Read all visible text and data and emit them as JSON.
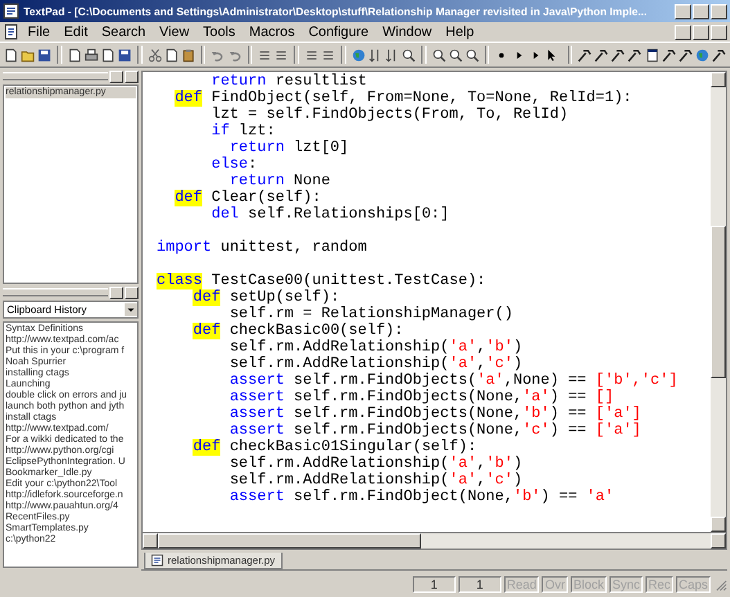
{
  "window": {
    "title": "TextPad - [C:\\Documents and Settings\\Administrator\\Desktop\\stuff\\Relationship Manager revisited in Java\\Python Imple..."
  },
  "menu": [
    "File",
    "Edit",
    "Search",
    "View",
    "Tools",
    "Macros",
    "Configure",
    "Window",
    "Help"
  ],
  "left_panel": {
    "documents": [
      {
        "label": "relationshipmanager.py",
        "selected": true
      }
    ],
    "clip_dropdown": "Clipboard History",
    "clips": [
      "Syntax Definitions",
      "http://www.textpad.com/ac",
      "Put this in your c:\\program f",
      "Noah Spurrier",
      "installing ctags",
      "Launching",
      "double click on errors and ju",
      "launch both python and jyth",
      "install ctags",
      "http://www.textpad.com/",
      "For a wikki dedicated to the",
      "http://www.python.org/cgi",
      "EclipsePythonIntegration. U",
      "Bookmarker_Idle.py",
      "Edit your c:\\python22\\Tool",
      "http://idlefork.sourceforge.n",
      "http://www.pauahtun.org/4",
      "RecentFiles.py",
      "SmartTemplates.py",
      "c:\\python22"
    ]
  },
  "editor": {
    "lines": [
      {
        "kind": "code",
        "segments": [
          {
            "kind": "kw",
            "text": "      return"
          },
          {
            "kind": "plain",
            "text": " resultlist"
          }
        ]
      },
      {
        "kind": "code",
        "segments": [
          {
            "kind": "def",
            "text": "  def"
          },
          {
            "kind": "plain",
            "text": " FindObject(self, From=None, To=None, RelId=1):"
          }
        ]
      },
      {
        "kind": "code",
        "segments": [
          {
            "kind": "plain",
            "text": "      lzt = self.FindObjects(From, To, RelId)"
          }
        ]
      },
      {
        "kind": "code",
        "segments": [
          {
            "kind": "kw",
            "text": "      if"
          },
          {
            "kind": "plain",
            "text": " lzt:"
          }
        ]
      },
      {
        "kind": "code",
        "segments": [
          {
            "kind": "kw",
            "text": "        return"
          },
          {
            "kind": "plain",
            "text": " lzt[0]"
          }
        ]
      },
      {
        "kind": "code",
        "segments": [
          {
            "kind": "kw",
            "text": "      else"
          },
          {
            "kind": "plain",
            "text": ":"
          }
        ]
      },
      {
        "kind": "code",
        "segments": [
          {
            "kind": "kw",
            "text": "        return"
          },
          {
            "kind": "plain",
            "text": " None"
          }
        ]
      },
      {
        "kind": "code",
        "segments": [
          {
            "kind": "def",
            "text": "  def"
          },
          {
            "kind": "plain",
            "text": " Clear(self):"
          }
        ]
      },
      {
        "kind": "code",
        "segments": [
          {
            "kind": "kw",
            "text": "      del"
          },
          {
            "kind": "plain",
            "text": " self.Relationships[0:]"
          }
        ]
      },
      {
        "kind": "blank"
      },
      {
        "kind": "code",
        "segments": [
          {
            "kind": "kw",
            "text": "import"
          },
          {
            "kind": "plain",
            "text": " unittest, random"
          }
        ]
      },
      {
        "kind": "blank"
      },
      {
        "kind": "code",
        "segments": [
          {
            "kind": "def",
            "text": "class"
          },
          {
            "kind": "plain",
            "text": " TestCase00(unittest.TestCase):"
          }
        ]
      },
      {
        "kind": "code",
        "segments": [
          {
            "kind": "def",
            "text": "    def"
          },
          {
            "kind": "plain",
            "text": " setUp(self):"
          }
        ]
      },
      {
        "kind": "code",
        "segments": [
          {
            "kind": "plain",
            "text": "        self.rm = RelationshipManager()"
          }
        ]
      },
      {
        "kind": "code",
        "segments": [
          {
            "kind": "def",
            "text": "    def"
          },
          {
            "kind": "plain",
            "text": " checkBasic00(self):"
          }
        ]
      },
      {
        "kind": "code",
        "segments": [
          {
            "kind": "plain",
            "text": "        self.rm.AddRelationship("
          },
          {
            "kind": "str",
            "text": "'a'"
          },
          {
            "kind": "plain",
            "text": ","
          },
          {
            "kind": "str",
            "text": "'b'"
          },
          {
            "kind": "plain",
            "text": ")"
          }
        ]
      },
      {
        "kind": "code",
        "segments": [
          {
            "kind": "plain",
            "text": "        self.rm.AddRelationship("
          },
          {
            "kind": "str",
            "text": "'a'"
          },
          {
            "kind": "plain",
            "text": ","
          },
          {
            "kind": "str",
            "text": "'c'"
          },
          {
            "kind": "plain",
            "text": ")"
          }
        ]
      },
      {
        "kind": "code",
        "segments": [
          {
            "kind": "kw",
            "text": "        assert"
          },
          {
            "kind": "plain",
            "text": " self.rm.FindObjects("
          },
          {
            "kind": "str",
            "text": "'a'"
          },
          {
            "kind": "plain",
            "text": ",None) == "
          },
          {
            "kind": "str",
            "text": "['b','c']"
          }
        ]
      },
      {
        "kind": "code",
        "segments": [
          {
            "kind": "kw",
            "text": "        assert"
          },
          {
            "kind": "plain",
            "text": " self.rm.FindObjects(None,"
          },
          {
            "kind": "str",
            "text": "'a'"
          },
          {
            "kind": "plain",
            "text": ") == "
          },
          {
            "kind": "str",
            "text": "[]"
          }
        ]
      },
      {
        "kind": "code",
        "segments": [
          {
            "kind": "kw",
            "text": "        assert"
          },
          {
            "kind": "plain",
            "text": " self.rm.FindObjects(None,"
          },
          {
            "kind": "str",
            "text": "'b'"
          },
          {
            "kind": "plain",
            "text": ") == "
          },
          {
            "kind": "str",
            "text": "['a']"
          }
        ]
      },
      {
        "kind": "code",
        "segments": [
          {
            "kind": "kw",
            "text": "        assert"
          },
          {
            "kind": "plain",
            "text": " self.rm.FindObjects(None,"
          },
          {
            "kind": "str",
            "text": "'c'"
          },
          {
            "kind": "plain",
            "text": ") == "
          },
          {
            "kind": "str",
            "text": "['a']"
          }
        ]
      },
      {
        "kind": "code",
        "segments": [
          {
            "kind": "def",
            "text": "    def"
          },
          {
            "kind": "plain",
            "text": " checkBasic01Singular(self):"
          }
        ]
      },
      {
        "kind": "code",
        "segments": [
          {
            "kind": "plain",
            "text": "        self.rm.AddRelationship("
          },
          {
            "kind": "str",
            "text": "'a'"
          },
          {
            "kind": "plain",
            "text": ","
          },
          {
            "kind": "str",
            "text": "'b'"
          },
          {
            "kind": "plain",
            "text": ")"
          }
        ]
      },
      {
        "kind": "code",
        "segments": [
          {
            "kind": "plain",
            "text": "        self.rm.AddRelationship("
          },
          {
            "kind": "str",
            "text": "'a'"
          },
          {
            "kind": "plain",
            "text": ","
          },
          {
            "kind": "str",
            "text": "'c'"
          },
          {
            "kind": "plain",
            "text": ")"
          }
        ]
      },
      {
        "kind": "code",
        "segments": [
          {
            "kind": "kw",
            "text": "        assert"
          },
          {
            "kind": "plain",
            "text": " self.rm.FindObject(None,"
          },
          {
            "kind": "str",
            "text": "'b'"
          },
          {
            "kind": "plain",
            "text": ") == "
          },
          {
            "kind": "str",
            "text": "'a'"
          }
        ]
      }
    ]
  },
  "tabs": [
    {
      "label": "relationshipmanager.py",
      "selected": true
    }
  ],
  "status_bar": {
    "line": "1",
    "column": "1",
    "indicators": [
      {
        "label": "Read",
        "on": false
      },
      {
        "label": "Ovr",
        "on": false
      },
      {
        "label": "Block",
        "on": false
      },
      {
        "label": "Sync",
        "on": false
      },
      {
        "label": "Rec",
        "on": false
      },
      {
        "label": "Caps",
        "on": false
      }
    ]
  }
}
